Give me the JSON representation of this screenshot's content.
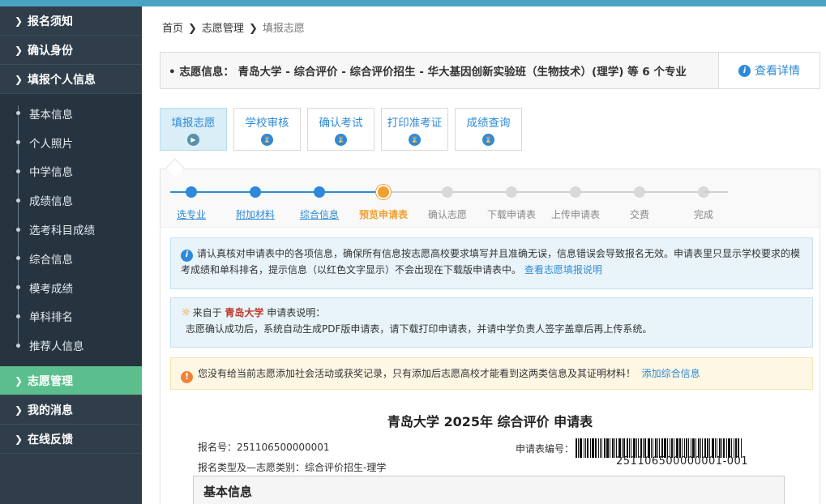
{
  "sidebar": {
    "top_items": [
      "报名须知",
      "确认身份",
      "填报个人信息"
    ],
    "sub_items": [
      "基本信息",
      "个人照片",
      "中学信息",
      "成绩信息",
      "选考科目成绩",
      "综合信息",
      "模考成绩",
      "单科排名",
      "推荐人信息"
    ],
    "bottom_items": [
      {
        "label": "志愿管理",
        "active": true
      },
      {
        "label": "我的消息",
        "active": false
      },
      {
        "label": "在线反馈",
        "active": false
      }
    ]
  },
  "breadcrumb": {
    "home": "首页",
    "level2": "志愿管理",
    "current": "填报志愿"
  },
  "info_bar": {
    "text": "志愿信息：  青岛大学 - 综合评价 - 综合评价招生 - 华大基因创新实验班（生物技术）(理学) 等 6 个专业",
    "detail_label": "查看详情"
  },
  "stage_tabs": [
    {
      "label": "填报志愿",
      "icon": "play-icon",
      "active": true
    },
    {
      "label": "学校审核",
      "icon": "hourglass-icon",
      "active": false
    },
    {
      "label": "确认考试",
      "icon": "hourglass-icon",
      "active": false
    },
    {
      "label": "打印准考证",
      "icon": "hourglass-icon",
      "active": false
    },
    {
      "label": "成绩查询",
      "icon": "hourglass-icon",
      "active": false
    }
  ],
  "progress_steps": [
    {
      "label": "选专业",
      "state": "done"
    },
    {
      "label": "附加材料",
      "state": "done"
    },
    {
      "label": "综合信息",
      "state": "done"
    },
    {
      "label": "预览申请表",
      "state": "current"
    },
    {
      "label": "确认志愿",
      "state": "todo"
    },
    {
      "label": "下载申请表",
      "state": "todo"
    },
    {
      "label": "上传申请表",
      "state": "todo"
    },
    {
      "label": "交费",
      "state": "todo"
    },
    {
      "label": "完成",
      "state": "todo"
    }
  ],
  "notice1": {
    "text": "请认真核对申请表中的各项信息，确保所有信息按志愿高校要求填写并且准确无误，信息错误会导致报名无效。申请表里只显示学校要求的模考成绩和单科排名，提示信息（以红色文字显示）不会出现在下载版申请表中。",
    "link": "查看志愿填报说明"
  },
  "notice2": {
    "prefix": "来自于",
    "school": "青岛大学",
    "suffix": "申请表说明：",
    "body": "志愿确认成功后，系统自动生成PDF版申请表，请下载打印申请表，并请中学负责人签字盖章后再上传系统。"
  },
  "notice3": {
    "text": "您没有给当前志愿添加社会活动或获奖记录，只有添加后志愿高校才能看到这两类信息及其证明材料！",
    "link": "添加综合信息"
  },
  "form": {
    "title": "青岛大学 2025年 综合评价 申请表",
    "reg_no": "报名号：251106500000001",
    "type": "报名类型及—志愿类别：综合评价招生-理学",
    "app_no_label": "申请表编号：",
    "app_no": "251106500000001-001",
    "section": "基本信息"
  },
  "colors": {
    "accent": "#2e8ad8",
    "sidebar_bg": "#2f3e4a",
    "active_green": "#5bbf8d",
    "current_step": "#f0a030"
  }
}
